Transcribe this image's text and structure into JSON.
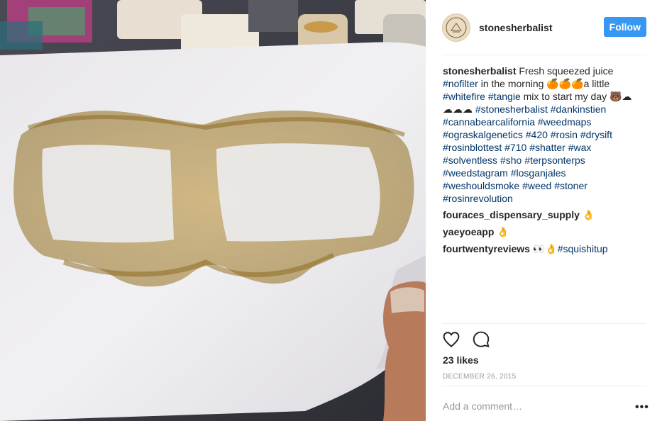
{
  "post": {
    "username": "stonesherbalist",
    "follow_label": "Follow",
    "avatar_text": "Stones"
  },
  "caption": {
    "username": "stonesherbalist",
    "lines": [
      [
        "Fresh squeezed juice"
      ],
      [
        "#nofilter",
        " in the morning ",
        "🍊🍊🍊",
        "a little"
      ],
      [
        "#whitefire",
        " ",
        "#tangie",
        " mix to start my day ",
        "🐻☁"
      ],
      [
        "☁☁☁",
        " ",
        "#stonesherbalist",
        " ",
        "#dankinstien"
      ],
      [
        "#cannabearcalifornia",
        " ",
        "#weedmaps"
      ],
      [
        "#ograskalgenetics",
        " ",
        "#420",
        " ",
        "#rosin",
        " ",
        "#drysift"
      ],
      [
        "#rosinblottest",
        " ",
        "#710",
        " ",
        "#shatter",
        " ",
        "#wax"
      ],
      [
        "#solventless",
        " ",
        "#sho",
        " ",
        "#terpsonterps"
      ],
      [
        "#weedstagram",
        " ",
        "#losganjales"
      ],
      [
        "#weshouldsmoke",
        " ",
        "#weed",
        " ",
        "#stoner"
      ],
      [
        "#rosinrevolution"
      ]
    ]
  },
  "comments": [
    {
      "user": "fouraces_dispensary_supply",
      "text": "👌"
    },
    {
      "user": "yaeyoeapp",
      "text": "👌"
    },
    {
      "user": "fourtwentyreviews",
      "text": "👀👌",
      "tag": "#squishitup"
    }
  ],
  "likes": "23 likes",
  "date": "DECEMBER 26, 2015",
  "add_comment_placeholder": "Add a comment…",
  "more_label": "•••",
  "icons": [
    "heart-icon",
    "comment-icon",
    "more-options-icon"
  ],
  "colors": {
    "follow": "#3897f0",
    "hashtag": "#003569",
    "text": "#262626",
    "muted": "#999999"
  }
}
